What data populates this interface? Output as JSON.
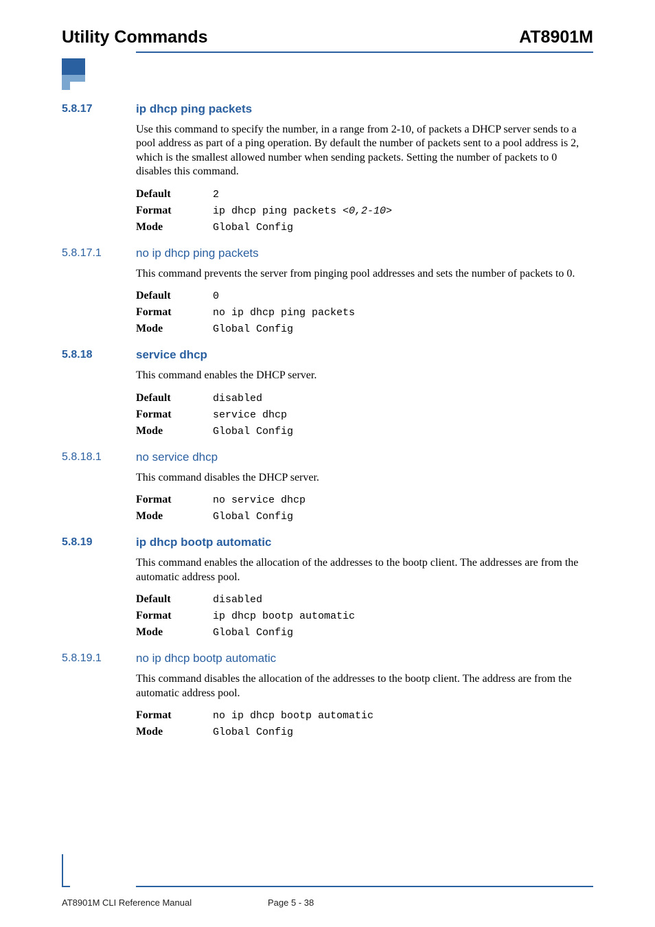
{
  "header": {
    "left": "Utility Commands",
    "right": "AT8901M"
  },
  "footer": {
    "left": "AT8901M CLI Reference Manual",
    "center": "Page 5 - 38"
  },
  "labels": {
    "default": "Default",
    "format": "Format",
    "mode": "Mode"
  },
  "s1": {
    "num": "5.8.17",
    "title": "ip dhcp ping packets",
    "desc": "Use this command to specify the number, in a range from 2-10, of packets a DHCP server sends to a pool address as part of a ping operation. By default the number of packets sent to a pool address is 2, which is the smallest allowed number when sending packets. Setting the number of packets to 0 disables this command.",
    "default": "2",
    "format_pre": "ip dhcp ping packets ",
    "format_arg": "<0,2-10>",
    "mode": "Global Config"
  },
  "s1a": {
    "num": "5.8.17.1",
    "title": "no ip dhcp ping packets",
    "desc": "This command prevents the server from pinging pool addresses and sets the number of packets to 0.",
    "default": "0",
    "format": "no ip dhcp ping packets",
    "mode": "Global Config"
  },
  "s2": {
    "num": "5.8.18",
    "title": "service dhcp",
    "desc": "This command enables the DHCP server.",
    "default": "disabled",
    "format": "service dhcp",
    "mode": "Global Config"
  },
  "s2a": {
    "num": "5.8.18.1",
    "title": "no service dhcp",
    "desc": "This command disables the DHCP server.",
    "format": "no service dhcp",
    "mode": "Global Config"
  },
  "s3": {
    "num": "5.8.19",
    "title": "ip dhcp bootp automatic",
    "desc": "This command enables the allocation of the addresses to the bootp client. The addresses are from the automatic address pool.",
    "default": "disabled",
    "format": "ip dhcp bootp automatic",
    "mode": "Global Config"
  },
  "s3a": {
    "num": "5.8.19.1",
    "title": "no ip dhcp bootp automatic",
    "desc": "This command disables the allocation of the addresses to the bootp client. The address are from the automatic address pool.",
    "format": "no ip dhcp bootp automatic",
    "mode": "Global Config"
  }
}
